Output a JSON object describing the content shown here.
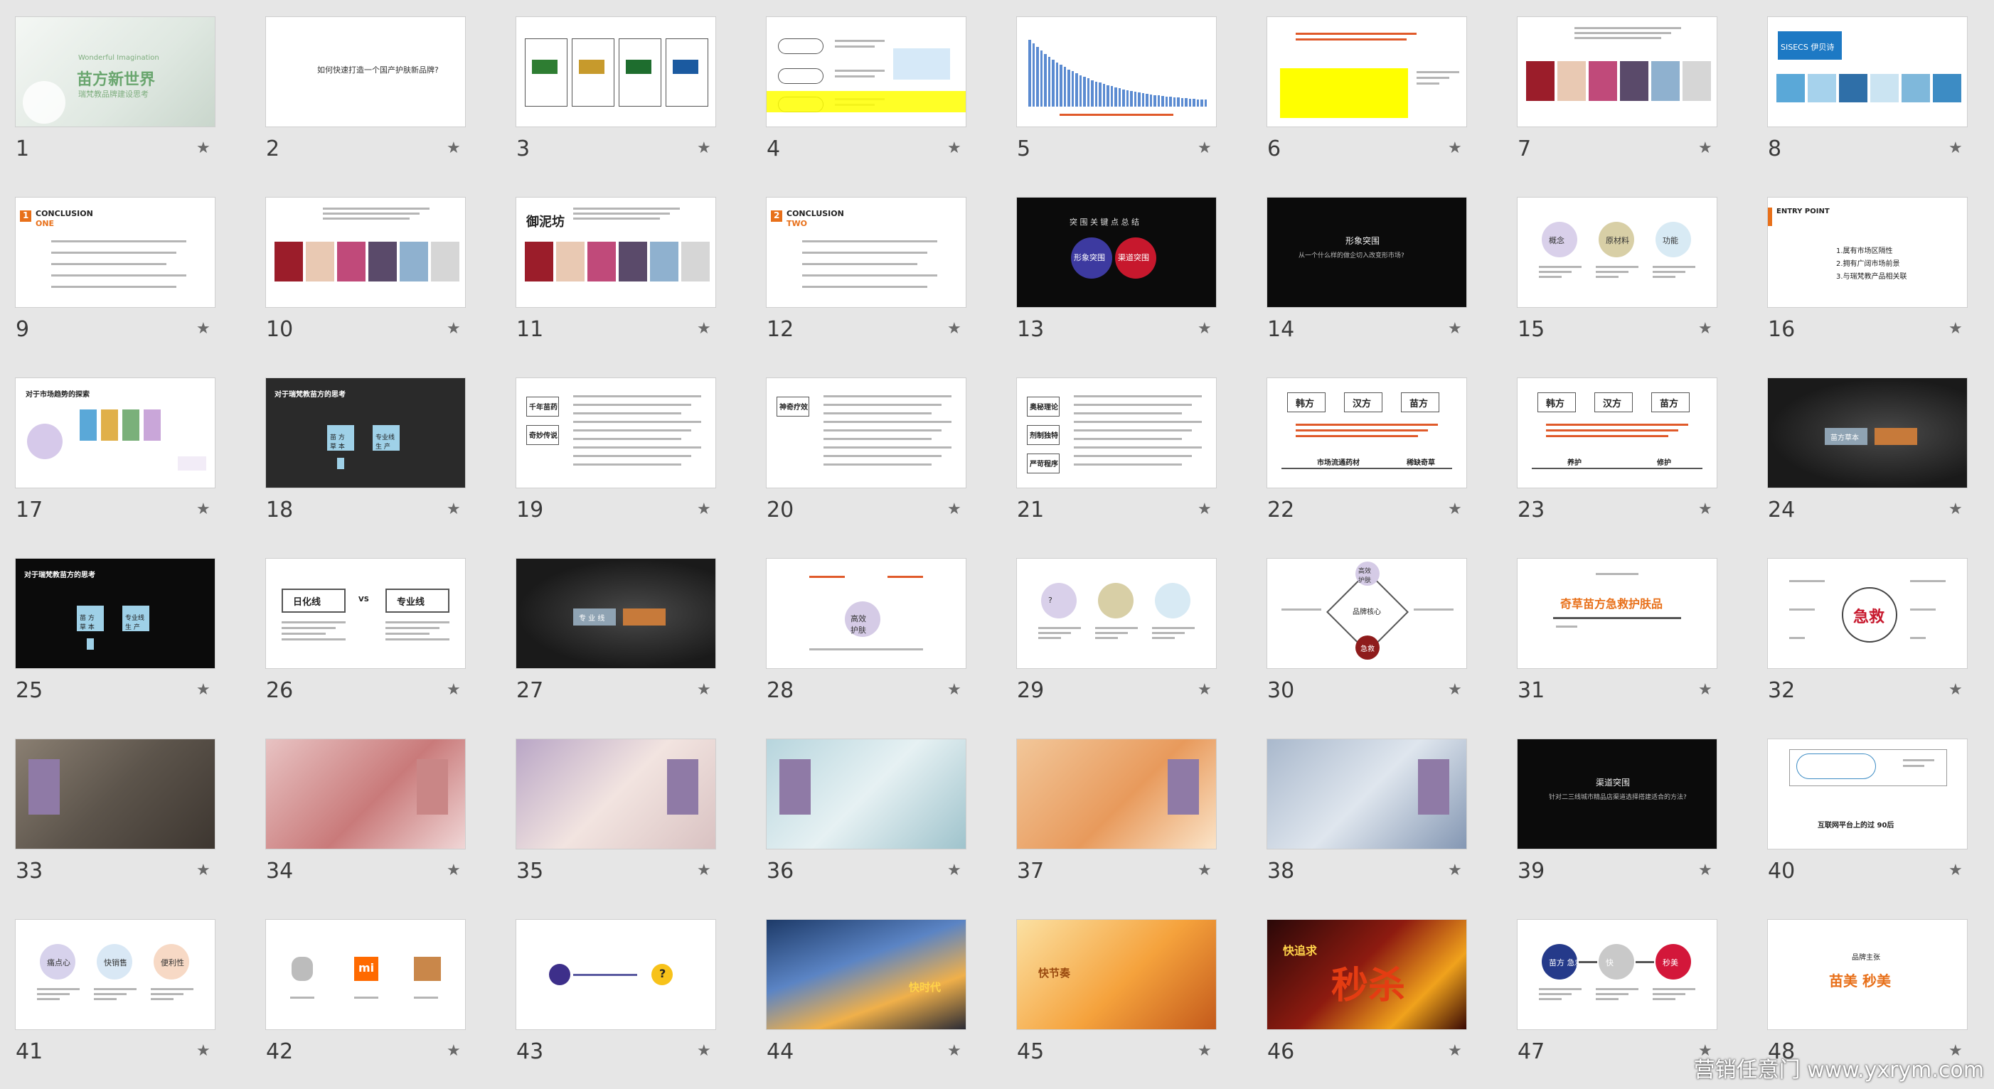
{
  "view": "slide-sorter",
  "watermark": "营销任意门 www.yxrym.com",
  "colors": {
    "background": "#e6e6e6",
    "accent_orange": "#e8701a",
    "accent_purple": "#8a6fb0",
    "slide_dark": "#0b0b0b"
  },
  "slides": [
    {
      "num": "1",
      "style": "photo",
      "bg": "linear-gradient(135deg,#f4f7f4 0%,#dfe8e1 60%,#c9d6cc 100%)",
      "texts": [
        "Wonderful Imagination",
        "苗方新世界",
        "瑞梵教品牌建设思考"
      ]
    },
    {
      "num": "2",
      "style": "text",
      "texts": [
        "如何快速打造一个国产护肤新品牌?"
      ]
    },
    {
      "num": "3",
      "style": "brands",
      "texts": []
    },
    {
      "num": "4",
      "style": "flow",
      "texts": []
    },
    {
      "num": "5",
      "style": "chart",
      "texts": []
    },
    {
      "num": "6",
      "style": "yellow",
      "texts": []
    },
    {
      "num": "7",
      "style": "collage",
      "texts": []
    },
    {
      "num": "8",
      "style": "collage-blue",
      "texts": [
        "SISECS 伊贝诗"
      ]
    },
    {
      "num": "9",
      "style": "conclusion",
      "texts": [
        "CONCLUSION",
        "ONE",
        "1"
      ]
    },
    {
      "num": "10",
      "style": "collage",
      "texts": []
    },
    {
      "num": "11",
      "style": "collage",
      "texts": [
        "御泥坊"
      ]
    },
    {
      "num": "12",
      "style": "conclusion",
      "texts": [
        "CONCLUSION",
        "TWO",
        "2"
      ]
    },
    {
      "num": "13",
      "style": "dark-circles",
      "texts": [
        "突 围 关 键 点 总 结",
        "形象突围",
        "渠道突围"
      ]
    },
    {
      "num": "14",
      "style": "dark-text",
      "texts": [
        "形象突围",
        "从一个什么样的做企切入改变形市场?"
      ]
    },
    {
      "num": "15",
      "style": "three-circles",
      "texts": [
        "概念",
        "原材料",
        "功能"
      ]
    },
    {
      "num": "16",
      "style": "entry",
      "texts": [
        "ENTRY POINT",
        "1.属有市场区隔性",
        "2.拥有广阔市场前景",
        "3.与瑞梵教产品相关联"
      ]
    },
    {
      "num": "17",
      "style": "market",
      "texts": [
        "对于市场趋势的探索"
      ]
    },
    {
      "num": "18",
      "style": "dark-boxes",
      "texts": [
        "对于瑞梵教苗方的思考",
        "苗 方 草 本",
        "专业线 生 产"
      ]
    },
    {
      "num": "19",
      "style": "legend",
      "texts": [
        "千年苗药",
        "奇妙传说"
      ]
    },
    {
      "num": "20",
      "style": "legend",
      "texts": [
        "神奇疗效"
      ]
    },
    {
      "num": "21",
      "style": "legend",
      "texts": [
        "奥秘理论",
        "剂制独特",
        "严苛程序"
      ]
    },
    {
      "num": "22",
      "style": "three-boxes",
      "texts": [
        "韩方",
        "汉方",
        "苗方",
        "市场流通药材",
        "稀缺奇草"
      ]
    },
    {
      "num": "23",
      "style": "three-boxes",
      "texts": [
        "韩方",
        "汉方",
        "苗方",
        "养护",
        "修护"
      ]
    },
    {
      "num": "24",
      "style": "dark-photo",
      "texts": [
        "苗方草本"
      ]
    },
    {
      "num": "25",
      "style": "dark-boxes",
      "texts": [
        "对于瑞梵教苗方的思考",
        "苗 方 草 本",
        "专业线 生 产"
      ]
    },
    {
      "num": "26",
      "style": "vs",
      "texts": [
        "日化线",
        "VS",
        "专业线"
      ]
    },
    {
      "num": "27",
      "style": "dark-photo",
      "texts": [
        "专 业 线"
      ]
    },
    {
      "num": "28",
      "style": "circle-center",
      "texts": [
        "高效 护肤"
      ]
    },
    {
      "num": "29",
      "style": "three-circles",
      "texts": [
        "?"
      ]
    },
    {
      "num": "30",
      "style": "diamond",
      "texts": [
        "高效 护肤",
        "品牌核心",
        "急救"
      ]
    },
    {
      "num": "31",
      "style": "tagline",
      "texts": [
        "奇草苗方急救护肤品"
      ]
    },
    {
      "num": "32",
      "style": "radial",
      "texts": [
        "急救"
      ]
    },
    {
      "num": "33",
      "style": "photo",
      "bg": "linear-gradient(135deg,#8a7f72 0%,#5c544b 50%,#3d3630 100%)",
      "texts": []
    },
    {
      "num": "34",
      "style": "photo",
      "bg": "linear-gradient(135deg,#e8c3c3 0%,#c97a7a 55%,#f0d6d6 100%)",
      "texts": []
    },
    {
      "num": "35",
      "style": "photo",
      "bg": "linear-gradient(135deg,#b9a6c6 0%,#f2e4e0 50%,#d9c2c2 100%)",
      "texts": []
    },
    {
      "num": "36",
      "style": "photo",
      "bg": "linear-gradient(135deg,#b7d5dd 0%,#e6f1f3 50%,#9fc3cc 100%)",
      "texts": []
    },
    {
      "num": "37",
      "style": "photo",
      "bg": "linear-gradient(135deg,#f2c79a 0%,#e89a5c 55%,#fbe4c8 100%)",
      "texts": []
    },
    {
      "num": "38",
      "style": "photo",
      "bg": "linear-gradient(135deg,#a9b8cc 0%,#dfe6ee 50%,#8497b3 100%)",
      "texts": []
    },
    {
      "num": "39",
      "style": "dark-text",
      "texts": [
        "渠道突围",
        "针对二三线城市精品店渠道选择搭建适合的方法?"
      ]
    },
    {
      "num": "40",
      "style": "pill",
      "texts": [
        "互联网平台上的过 90后"
      ]
    },
    {
      "num": "41",
      "style": "three-circles",
      "texts": [
        "痛点心",
        "快销售",
        "便利性"
      ]
    },
    {
      "num": "42",
      "style": "icons",
      "texts": [
        "mi"
      ]
    },
    {
      "num": "43",
      "style": "arrow",
      "texts": [
        "?"
      ]
    },
    {
      "num": "44",
      "style": "photo",
      "bg": "linear-gradient(160deg,#1d3a68 0%,#5b84c4 40%,#f0b04a 70%,#2b2b35 100%)",
      "texts": [
        "快时代"
      ]
    },
    {
      "num": "45",
      "style": "photo",
      "bg": "linear-gradient(135deg,#fbe1a3 0%,#f5a23c 55%,#c45a1b 100%)",
      "texts": [
        "快节奏"
      ]
    },
    {
      "num": "46",
      "style": "photo",
      "bg": "linear-gradient(135deg,#2a0808 0%,#8e1b10 45%,#f0a21c 75%,#3a0a05 100%)",
      "texts": [
        "快追求",
        "秒杀"
      ]
    },
    {
      "num": "47",
      "style": "three-circles",
      "texts": [
        "苗方 急救 美丽",
        "快",
        "秒美"
      ]
    },
    {
      "num": "48",
      "style": "tagline",
      "texts": [
        "品牌主张",
        "苗美 秒美"
      ]
    }
  ]
}
